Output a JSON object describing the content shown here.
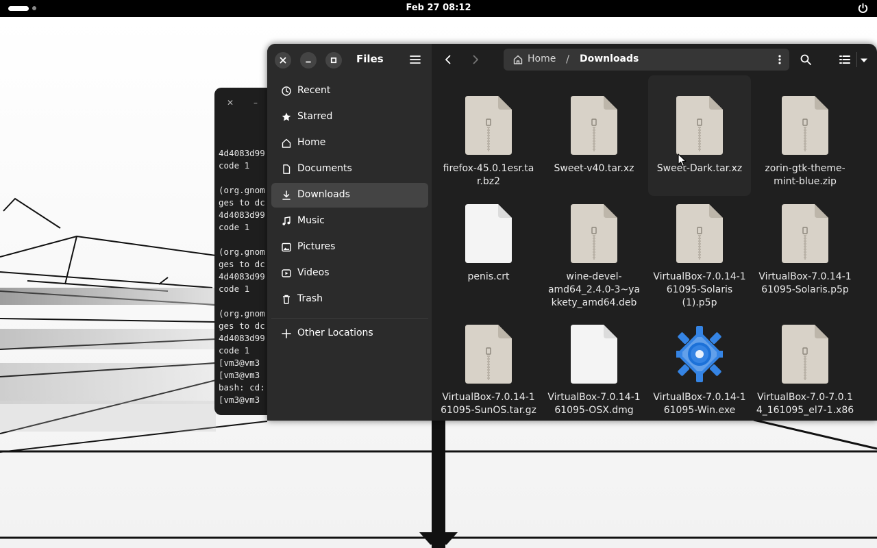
{
  "topbar": {
    "clock": "Feb 27  08:12",
    "icons": [
      "workspace-indicator",
      "power-icon"
    ]
  },
  "terminal": {
    "lines": [
      "4d4083d99",
      "code 1",
      "",
      "(org.gnom",
      "ges to dc",
      "4d4083d99",
      "code 1",
      "",
      "(org.gnom",
      "ges to dc",
      "4d4083d99",
      "code 1",
      "",
      "(org.gnom",
      "ges to dc",
      "4d4083d99",
      "code 1",
      "[vm3@vm3",
      "[vm3@vm3",
      "bash: cd:",
      "[vm3@vm3"
    ]
  },
  "files": {
    "title": "Files",
    "sidebar": {
      "items": [
        {
          "label": "Recent",
          "icon": "clock-icon"
        },
        {
          "label": "Starred",
          "icon": "star-icon"
        },
        {
          "label": "Home",
          "icon": "home-icon"
        },
        {
          "label": "Documents",
          "icon": "document-icon"
        },
        {
          "label": "Downloads",
          "icon": "download-icon",
          "active": true
        },
        {
          "label": "Music",
          "icon": "music-icon"
        },
        {
          "label": "Pictures",
          "icon": "picture-icon"
        },
        {
          "label": "Videos",
          "icon": "video-icon"
        },
        {
          "label": "Trash",
          "icon": "trash-icon"
        }
      ],
      "other": {
        "label": "Other Locations",
        "icon": "plus-icon"
      }
    },
    "path": {
      "home": "Home",
      "separator": "/",
      "current": "Downloads"
    },
    "items": [
      {
        "name": "firefox-45.0.1esr.ta\nr.bz2",
        "type": "archive"
      },
      {
        "name": "Sweet-v40.tar.xz",
        "type": "archive"
      },
      {
        "name": "Sweet-Dark.tar.xz",
        "type": "archive",
        "hover": true
      },
      {
        "name": "zorin-gtk-theme-\nmint-blue.zip",
        "type": "archive"
      },
      {
        "name": "penis.crt",
        "type": "blank"
      },
      {
        "name": "wine-devel-\namd64_2.4.0-3~ya\nkkety_amd64.deb",
        "type": "archive"
      },
      {
        "name": "VirtualBox-7.0.14-1\n61095-Solaris\n(1).p5p",
        "type": "archive"
      },
      {
        "name": "VirtualBox-7.0.14-1\n61095-Solaris.p5p",
        "type": "archive"
      },
      {
        "name": "VirtualBox-7.0.14-1\n61095-SunOS.tar.gz",
        "type": "archive"
      },
      {
        "name": "VirtualBox-7.0.14-1\n61095-OSX.dmg",
        "type": "blank"
      },
      {
        "name": "VirtualBox-7.0.14-1\n61095-Win.exe",
        "type": "exe"
      },
      {
        "name": "VirtualBox-7.0-7.0.1\n4_161095_el7-1.x86",
        "type": "archive"
      }
    ]
  },
  "colors": {
    "window_bg": "#1f1f1f",
    "sidebar_bg": "#2b2b2b",
    "active_row": "#444444",
    "archive_thumb": "#d8d2c8",
    "exe_gear": "#3584e4"
  }
}
